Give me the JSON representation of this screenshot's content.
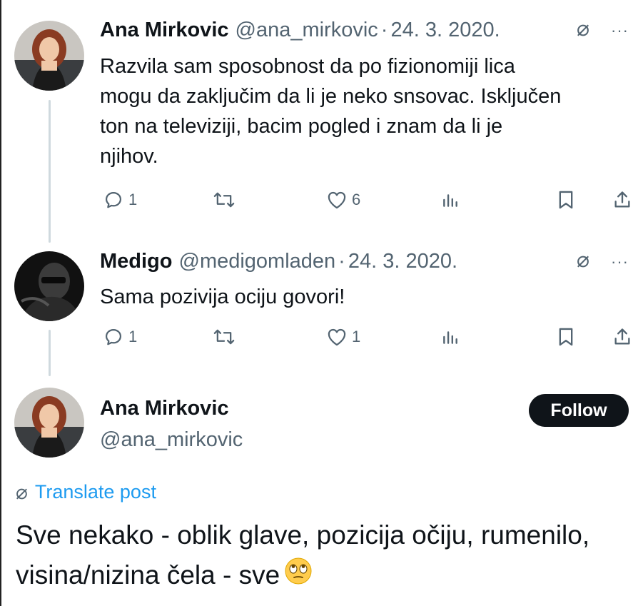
{
  "colors": {
    "text": "#0f1419",
    "secondary": "#536471",
    "accent": "#1d9bf0",
    "follow_bg": "#0f1419",
    "thread_line": "#cfd9de"
  },
  "tweet1": {
    "name": "Ana Mirkovic",
    "handle": "@ana_mirkovic",
    "separator": "·",
    "date": "24. 3. 2020.",
    "translate_icon": "⌀",
    "more_icon": "···",
    "lines": [
      "Razvila sam sposobnost da po fizionomiji lica",
      "mogu da zaključim da li je neko snsovac. Isključen",
      "ton na televiziji, bacim pogled i znam da li je",
      "njihov."
    ],
    "replies": "1",
    "likes": "6"
  },
  "tweet2": {
    "name": "Medigo",
    "handle": "@medigomladen",
    "separator": "·",
    "date": "24. 3. 2020.",
    "translate_icon": "⌀",
    "more_icon": "···",
    "text": "Sama pozivija ociju govori!",
    "replies": "1",
    "likes": "1"
  },
  "main": {
    "name": "Ana Mirkovic",
    "handle": "@ana_mirkovic",
    "follow_label": "Follow",
    "translate_icon": "⌀",
    "translate_label": "Translate post",
    "text_line1": "Sve nekako - oblik glave, pozicija očiju, rumenilo,",
    "text_line2": "visina/nizina čela - sve"
  },
  "icons": [
    "reply-icon",
    "retweet-icon",
    "like-icon",
    "views-icon",
    "bookmark-icon",
    "share-icon",
    "face-with-rolling-eyes-emoji"
  ]
}
